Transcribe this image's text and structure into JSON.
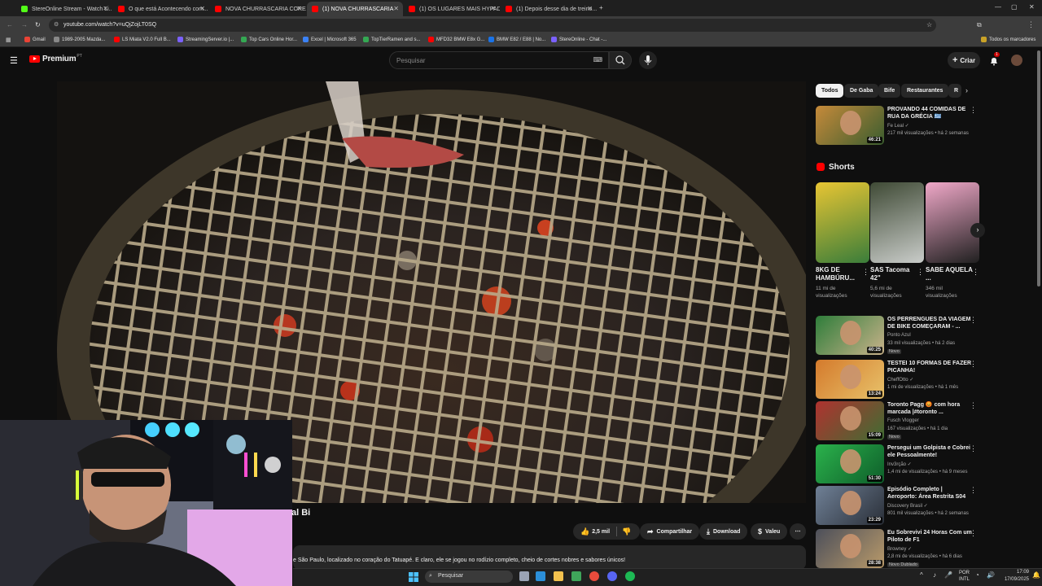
{
  "browser": {
    "tabs": [
      {
        "label": "StereOnline Stream - Watch Li...",
        "color": "#53fc18",
        "active": false
      },
      {
        "label": "O que está Acontecendo com...",
        "color": "#ff0000",
        "active": false
      },
      {
        "label": "NOVA CHURRASCARIA COREA...",
        "color": "#ff0000",
        "active": false
      },
      {
        "label": "(1) NOVA CHURRASCARIA",
        "color": "#ff0000",
        "active": true
      },
      {
        "label": "(1) OS LUGARES MAIS HYPADO...",
        "color": "#ff0000",
        "active": false
      },
      {
        "label": "(1) Depois desse dia de treino...",
        "color": "#ff0000",
        "active": false
      }
    ],
    "url": "youtube.com/watch?v=uQjZojLT0SQ",
    "bookmarks": [
      {
        "label": "Gmail",
        "color": "#ea4335"
      },
      {
        "label": "1989-2005 Mazda...",
        "color": "#888888"
      },
      {
        "label": "LS Miata V2.0 Full B...",
        "color": "#ff0000"
      },
      {
        "label": "StreamingServer.io |...",
        "color": "#7b61ff"
      },
      {
        "label": "Top Cars Online Hor...",
        "color": "#34a853"
      },
      {
        "label": "Excel | Microsoft 365",
        "color": "#3b82f6"
      },
      {
        "label": "TopTierRamen and s...",
        "color": "#34a853"
      },
      {
        "label": "MFD32 BMW E8x G...",
        "color": "#ff0000"
      },
      {
        "label": "BMW E82 / E88 | No...",
        "color": "#1a73e8"
      },
      {
        "label": "StereOnline - Chat -...",
        "color": "#7b61ff"
      }
    ],
    "all_bookmarks": "Todos os marcadores"
  },
  "youtube": {
    "brand": "Premium",
    "brand_sup": "PT",
    "search_placeholder": "Pesquisar",
    "create_label": "Criar",
    "notif_count": "1",
    "title_fragment": "al Bi",
    "likes": "2,5 mil",
    "share_label": "Compartilhar",
    "download_label": "Download",
    "valeu_label": "Valeu",
    "description": "e São Paulo, localizado no coração do Tatuapé. E claro, ele se jogou no rodízio completo, cheio de cortes nobres e sabores únicos!",
    "chips": [
      "Todos",
      "De Gaba",
      "Bife",
      "Restaurantes",
      "R"
    ],
    "shorts_heading": "Shorts",
    "shorts": [
      {
        "title": "8KG DE HAMBÚRU...",
        "views": "11 mi de visualizações"
      },
      {
        "title": "SAS Tacoma 42\"",
        "views": "5,6 mi de visualizações"
      },
      {
        "title": "SABE AQUELA ...",
        "views": "346 mil visualizações"
      }
    ],
    "recommended_top": {
      "title": "PROVANDO 44 COMIDAS DE RUA DA GRÉCIA 🇬🇷 MELHORE...",
      "channel": "Fe Leal ✓",
      "meta": "217 mil visualizações • há 2 semanas",
      "duration": "46:21"
    },
    "recommended": [
      {
        "title": "OS PERRENGUES DA VIAGEM DE BIKE COMEÇARAM - ...",
        "channel": "Ponto Azul",
        "meta": "33 mil visualizações • há 2 dias",
        "duration": "40:25",
        "badge": "Novo"
      },
      {
        "title": "TESTEI 10 FORMAS DE FAZER PICANHA!",
        "channel": "CheffOtto ✓",
        "meta": "1 mi de visualizações • há 1 mês",
        "duration": "13:24",
        "badge": ""
      },
      {
        "title": "Toronto Pagg 😡 com hora marcada |#toronto ...",
        "channel": "Fusch Vlogger",
        "meta": "167 visualizações • há 1 dia",
        "duration": "15:09",
        "badge": "Novo"
      },
      {
        "title": "Persegui um Golpista e Cobrei ele Pessoalmente!",
        "channel": "Inv3rção ✓",
        "meta": "1,4 mi de visualizações • há 9 meses",
        "duration": "51:30",
        "badge": ""
      },
      {
        "title": "Episódio Completo | Aeroporto: Área Restrita S04 Ep07 | ...",
        "channel": "Discovery Brasil ✓",
        "meta": "801 mil visualizações • há 2 semanas",
        "duration": "23:29",
        "badge": ""
      },
      {
        "title": "Eu Sobrevivi 24 Horas Com um Piloto de F1",
        "channel": "Browney ✓",
        "meta": "2,8 mi de visualizações • há 6 dias",
        "duration": "28:38",
        "badge": "Novo  Dublado"
      }
    ]
  },
  "taskbar": {
    "search": "Pesquisar",
    "lang": "POR",
    "lang2": "INTL",
    "time": "17:09",
    "date": "17/09/2025"
  }
}
